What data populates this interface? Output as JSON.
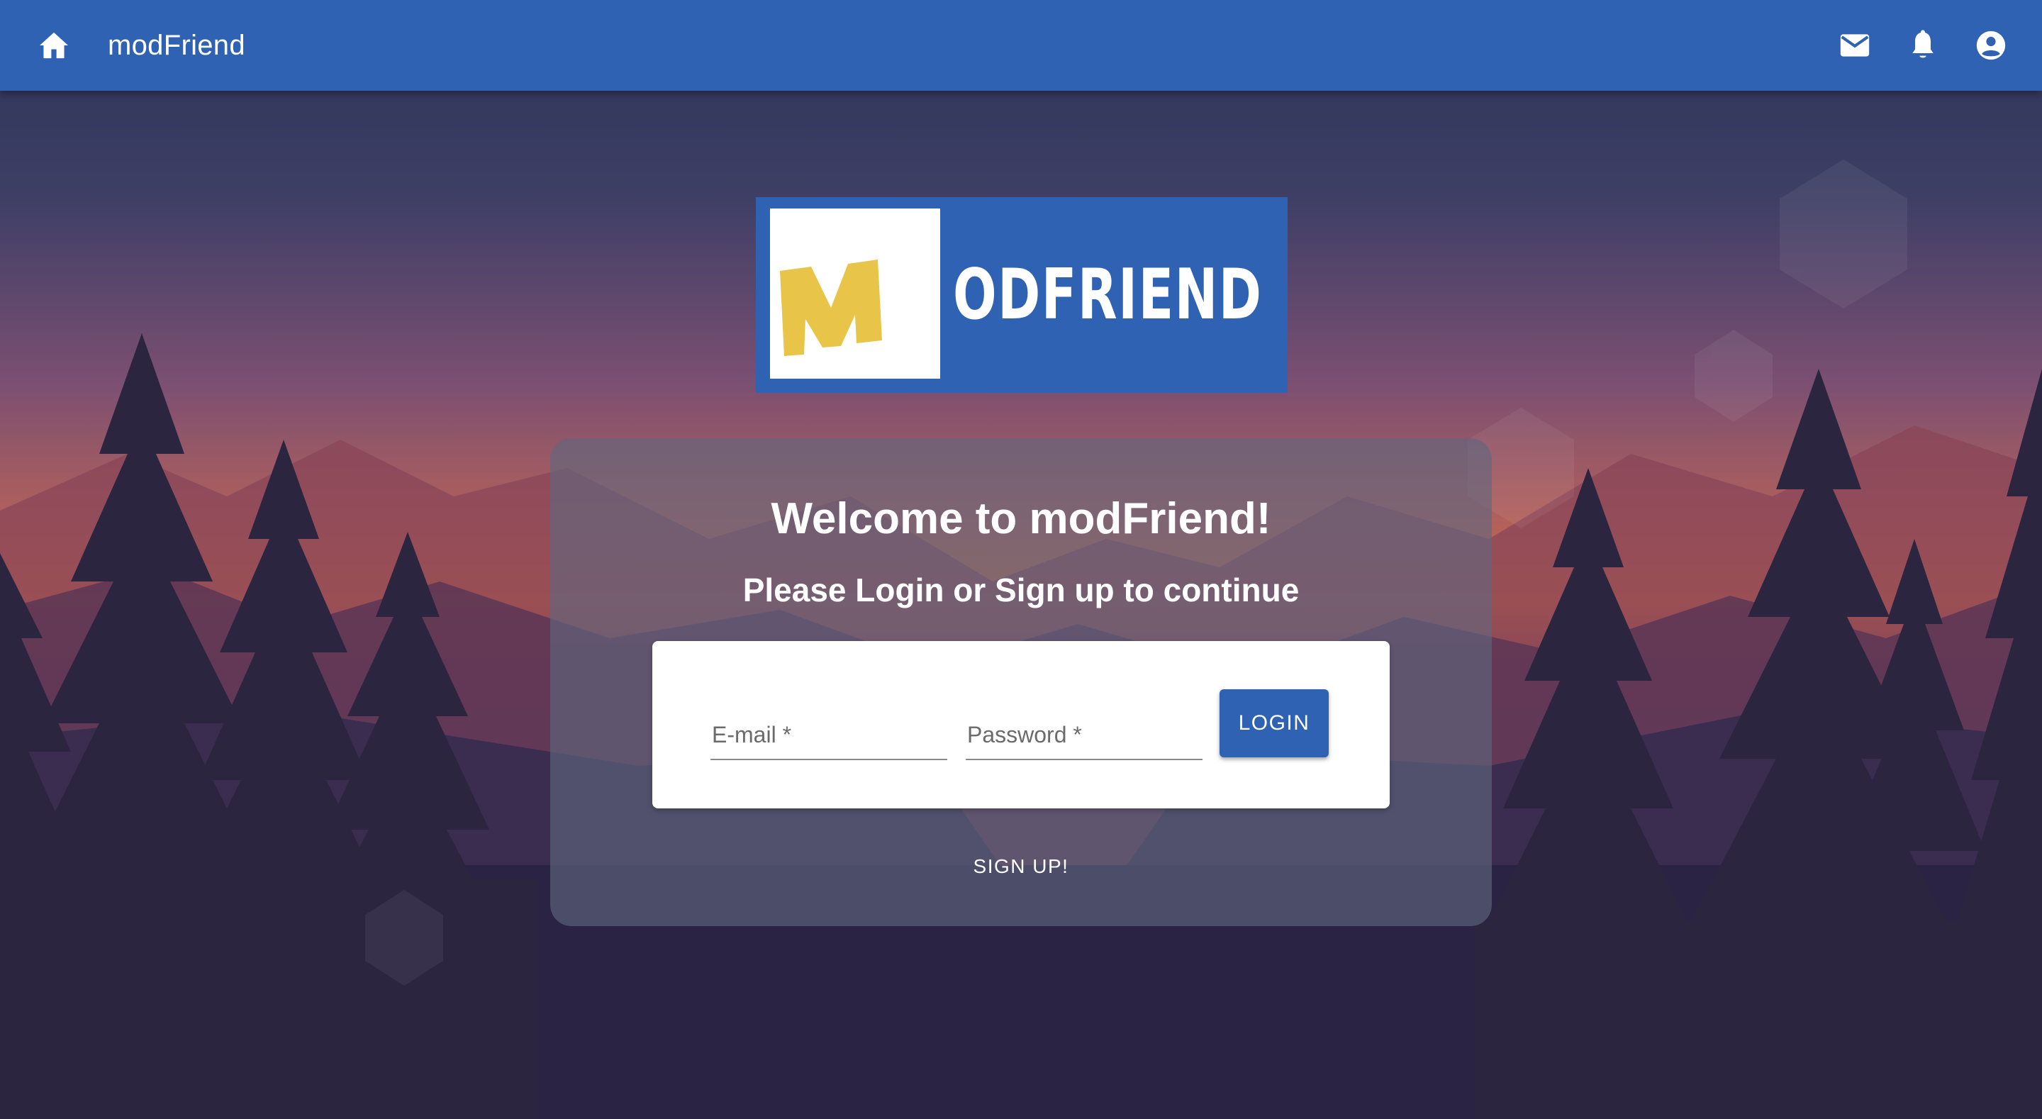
{
  "appbar": {
    "title": "modFriend",
    "home_icon": "home-icon",
    "mail_icon": "mail-icon",
    "notifications_icon": "bell-icon",
    "account_icon": "account-circle-icon",
    "color": "#2f62b2"
  },
  "logo": {
    "text": "ODFRIEND",
    "letter": "M",
    "background_color": "#2f62b2",
    "letter_color": "#e8c548"
  },
  "card": {
    "welcome": "Welcome to modFriend!",
    "subtitle": "Please Login or Sign up to continue",
    "email_label": "E-mail *",
    "password_label": "Password *",
    "email_value": "",
    "password_value": "",
    "login_label": "LOGIN",
    "signup_label": "SIGN UP!"
  },
  "colors": {
    "accent": "#2f62b2",
    "sky_top": "#2c3456",
    "sky_glow": "#c96a4a",
    "ground": "#272240"
  }
}
